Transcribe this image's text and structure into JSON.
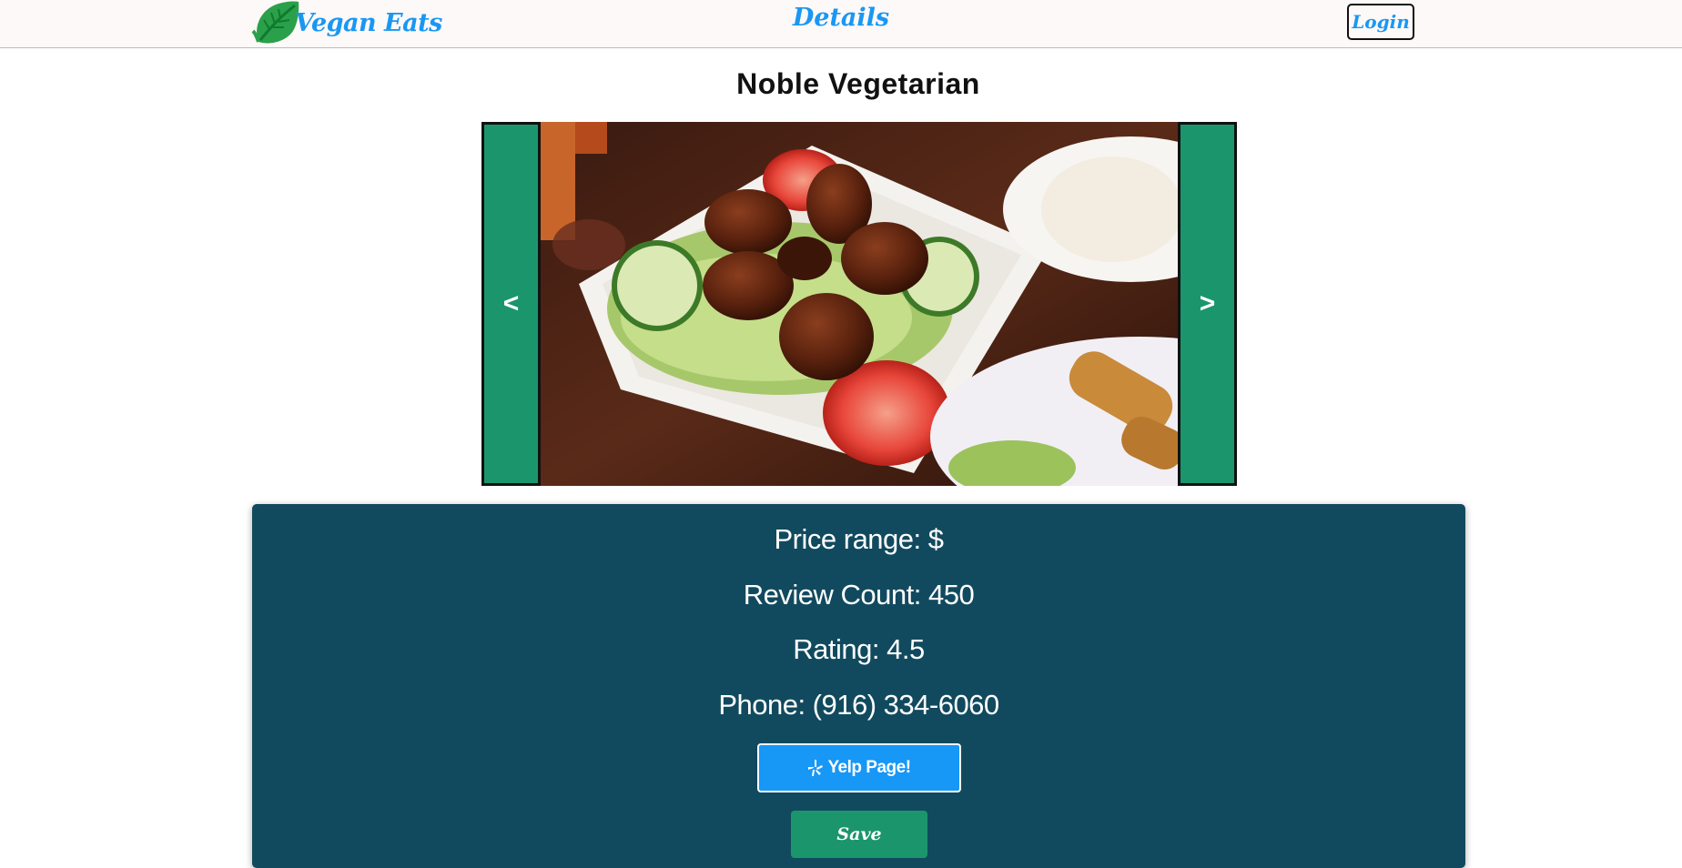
{
  "navbar": {
    "brand_text": "Vegan Eats",
    "brand_icon": "leaf-logo-icon",
    "center_title": "Details",
    "login_label": "Login"
  },
  "restaurant": {
    "name": "Noble Vegetarian"
  },
  "carousel": {
    "prev_label": "<",
    "next_label": ">",
    "photo_alt": "Plate of glazed drumsticks with lettuce, cucumber and tomato slices"
  },
  "info": {
    "price_label": "Price range: $",
    "review_label": "Review Count: 450",
    "rating_label": "Rating: 4.5",
    "phone_label": "Phone: (916) 334-6060",
    "yelp_label": "Yelp Page!",
    "yelp_icon": "yelp-icon",
    "save_label": "Save"
  },
  "colors": {
    "brand_blue": "#1a97f3",
    "accent_green": "#1b966c",
    "card_teal": "#114a5e",
    "yelp_blue": "#1797f6"
  }
}
